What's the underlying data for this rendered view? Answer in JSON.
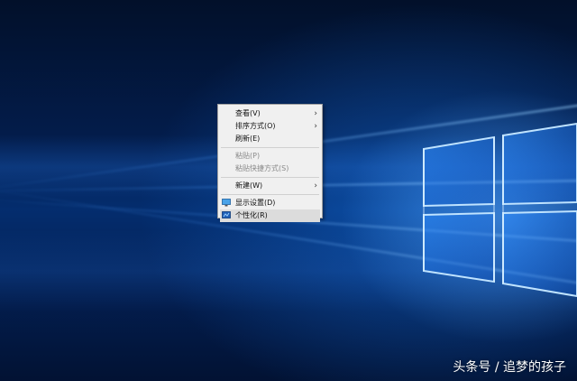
{
  "context_menu": {
    "items": [
      {
        "label": "查看(V)",
        "has_submenu": true,
        "enabled": true
      },
      {
        "label": "排序方式(O)",
        "has_submenu": true,
        "enabled": true
      },
      {
        "label": "刷新(E)",
        "has_submenu": false,
        "enabled": true
      },
      {
        "label": "粘贴(P)",
        "has_submenu": false,
        "enabled": false
      },
      {
        "label": "粘贴快捷方式(S)",
        "has_submenu": false,
        "enabled": false
      },
      {
        "label": "新建(W)",
        "has_submenu": true,
        "enabled": true
      },
      {
        "label": "显示设置(D)",
        "has_submenu": false,
        "enabled": true,
        "icon": "display-settings-icon"
      },
      {
        "label": "个性化(R)",
        "has_submenu": false,
        "enabled": true,
        "icon": "personalize-icon",
        "highlighted": true
      }
    ],
    "submenu_glyph": "›"
  },
  "watermark": {
    "text": "头条号 / 追梦的孩子"
  },
  "colors": {
    "desktop_dark": "#03152f",
    "desktop_blue": "#0a4aa8",
    "menu_bg": "#f0f0f0",
    "menu_highlight": "#dcdcdc",
    "disabled_text": "#8a8a8a"
  }
}
